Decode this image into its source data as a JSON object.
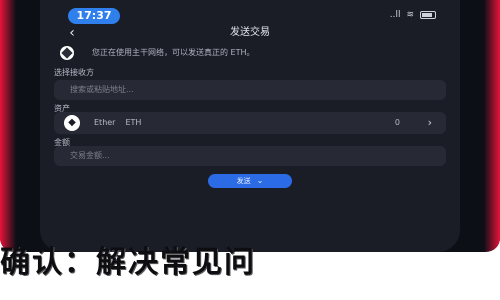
{
  "status_bar": {
    "time": "17:37",
    "signal_label": "..ll",
    "wifi_label": "≋"
  },
  "nav": {
    "title": "发送交易",
    "back_icon": "chevron-left-icon"
  },
  "notice": {
    "icon": "diamond-icon",
    "text": "您正在使用主干网络，可以发送真正的 ETH。"
  },
  "fields": {
    "recipient": {
      "label": "选择接收方",
      "placeholder": "搜索或粘贴地址..."
    },
    "asset": {
      "label": "资产",
      "name": "Ether",
      "symbol": "ETH",
      "balance": "0",
      "icon": "ethereum-icon"
    },
    "amount": {
      "label": "金额",
      "placeholder": "交易金额..."
    }
  },
  "actions": {
    "submit_label": "发送",
    "submit_icon": "chevron-down-icon"
  },
  "caption": {
    "text": "确认：解决常见问"
  },
  "colors": {
    "accent": "#2b6be6",
    "edge_glow": "#e8133a",
    "screen_bg": "#1a1d26",
    "field_bg": "#272a34"
  }
}
